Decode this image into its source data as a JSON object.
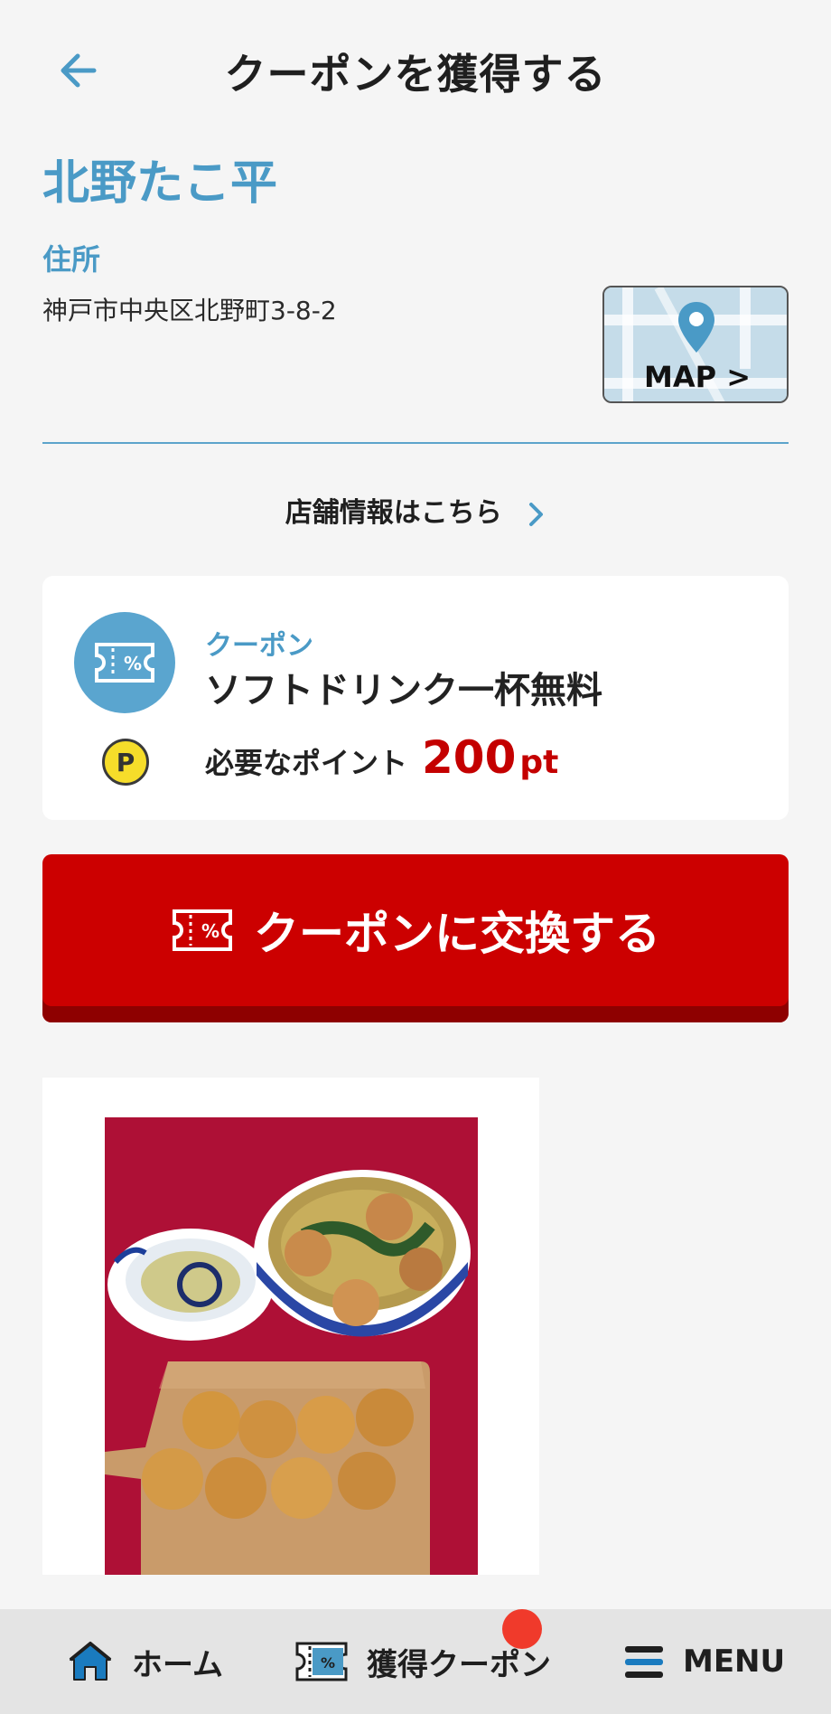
{
  "header": {
    "title": "クーポンを獲得する"
  },
  "store": {
    "name": "北野たこ平",
    "address_label": "住所",
    "address": "神戸市中央区北野町3-8-2",
    "map_label": "MAP >",
    "info_link": "店舗情報はこちら"
  },
  "coupon": {
    "type_label": "クーポン",
    "name": "ソフトドリンク一杯無料",
    "point_label": "必要なポイント",
    "point_value": "200",
    "point_unit": "pt",
    "point_icon": "P"
  },
  "exchange_button": {
    "label": "クーポンに交換する"
  },
  "tabbar": {
    "home": "ホーム",
    "coupons": "獲得クーポン",
    "menu": "MENU"
  },
  "colors": {
    "accent_blue": "#4a9ac6",
    "primary_red": "#cc0000",
    "badge_red": "#f03a2b"
  },
  "icons": {
    "back": "arrow-left-icon",
    "map_pin": "map-pin-icon",
    "chevron": "chevron-right-icon",
    "coupon": "coupon-ticket-icon",
    "point": "point-coin-icon",
    "home": "home-icon",
    "menu": "hamburger-icon"
  }
}
